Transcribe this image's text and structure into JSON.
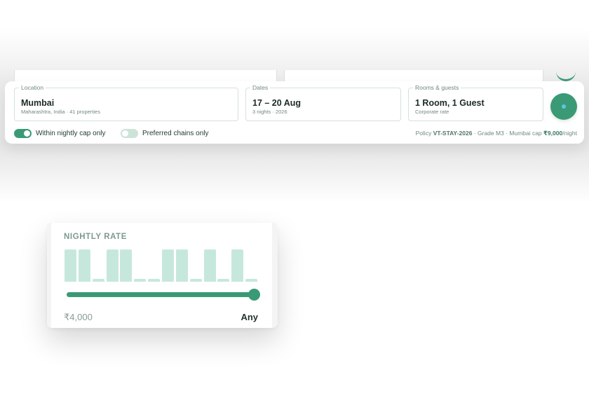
{
  "search": {
    "location": {
      "legend": "Location",
      "value": "Mumbai",
      "sub": "Maharashtra, India · 41 properties"
    },
    "dates": {
      "legend": "Dates",
      "value": "17 – 20 Aug",
      "sub": "3 nights · 2026"
    },
    "rooms": {
      "legend": "Rooms & guests",
      "value": "1 Room, 1 Guest",
      "sub": "Corporate rate"
    }
  },
  "filters": {
    "nightly_cap": {
      "label": "Within nightly cap only",
      "on": true
    },
    "preferred_chains": {
      "label": "Preferred chains only",
      "on": false
    }
  },
  "policy": {
    "prefix": "Policy ",
    "code": "VT-STAY-2026",
    "middle": " · Grade M3 · Mumbai cap ",
    "cap": "₹9,000",
    "suffix": "/night"
  },
  "nightly_rate": {
    "title": "NIGHTLY RATE",
    "histogram_levels": [
      1,
      1,
      0.08,
      1,
      1,
      0.08,
      0.08,
      1,
      1,
      0.08,
      1,
      0.08,
      1,
      0.08
    ],
    "min_label": "₹4,000",
    "max_label": "Any",
    "slider_fraction": 1.0
  },
  "colors": {
    "accent": "#3a9a76",
    "bar": "#c6e8dc",
    "muted": "#6f8a7c"
  }
}
